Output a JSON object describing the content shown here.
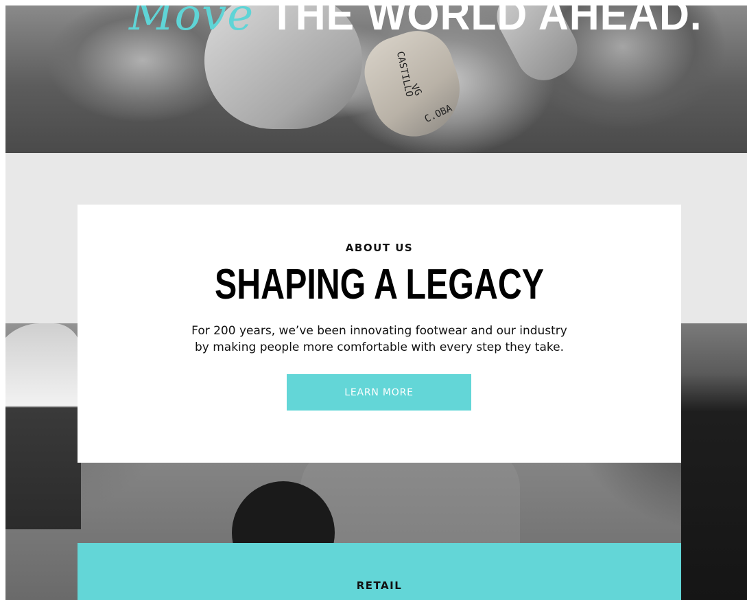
{
  "hero": {
    "title_script": "Move",
    "title_bold": "THE WORLD AHEAD.",
    "image_scribbles": [
      "CASTILLO",
      "C.OBA",
      "VG"
    ]
  },
  "about": {
    "eyebrow": "ABOUT US",
    "title": "SHAPING A LEGACY",
    "body_line1": "For 200 years, we’ve been innovating footwear and our industry",
    "body_line2": "by making people more comfortable with every step they take.",
    "button_label": "LEARN MORE"
  },
  "retail": {
    "eyebrow": "RETAIL"
  },
  "colors": {
    "accent": "#63d6d7",
    "band": "#e8e8e8",
    "card": "#ffffff",
    "text": "#111111"
  }
}
